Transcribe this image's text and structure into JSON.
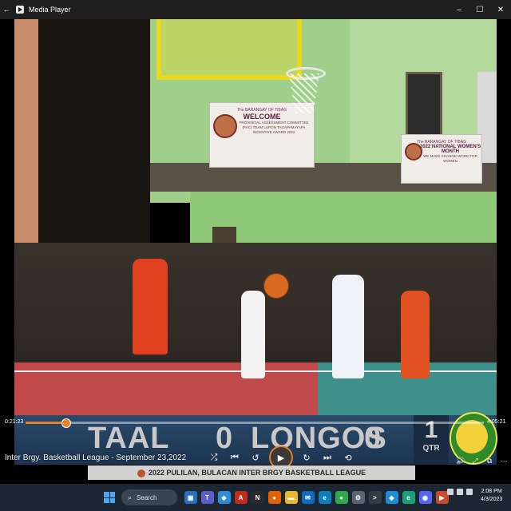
{
  "window": {
    "title": "Media Player",
    "back_icon": "back-arrow-icon",
    "controls": {
      "minimize": "–",
      "maximize": "☐",
      "close": "✕"
    }
  },
  "video_scene": {
    "banner_left": {
      "line1": "The BARANGAY OF TIBAG",
      "line2": "WELCOME",
      "line3": "PROVINCIAL ASSESSMENT COMMITTEE (PAC) TEAM LUPON TAGAPAMAYAPA INCENTIVE AWARD 2022"
    },
    "banner_right": {
      "line1": "The BARANGAY OF TIBAG",
      "line2": "2022 NATIONAL WOMEN'S MONTH",
      "line3": "WE MAKE CHANGE WORK FOR WOMEN"
    }
  },
  "scoreboard": {
    "team_a": "TAAL",
    "score_a": "0",
    "team_b": "LONGOS",
    "score_b": "0",
    "quarter_number": "1",
    "quarter_label": "QTR",
    "bottom_banner": "2022 PULILAN, BULACAN INTER BRGY BASKETBALL LEAGUE"
  },
  "player": {
    "elapsed": "0:21:23",
    "duration": "4:05:21",
    "progress_fraction": 0.087,
    "media_title": "Inter Brgy. Basketball League - September 23,2022",
    "controls": {
      "shuffle": "⤮",
      "previous": "⏮",
      "rewind": "↺",
      "play": "▶",
      "forward": "↻",
      "next": "⏭",
      "repeat": "⟲"
    },
    "right_controls": {
      "volume": "🔊",
      "fullscreen": "⤢",
      "miniplayer": "⧉",
      "more": "⋯"
    }
  },
  "taskbar": {
    "search_placeholder": "Search",
    "time": "2:08 PM",
    "date": "4/3/2023",
    "apps": [
      {
        "icon": "files-icon",
        "glyph": "▣",
        "color": "#2a6fb8"
      },
      {
        "icon": "teams-icon",
        "glyph": "T",
        "color": "#5b5fc7"
      },
      {
        "icon": "store-icon",
        "glyph": "◈",
        "color": "#2d8cd9"
      },
      {
        "icon": "pdf-icon",
        "glyph": "A",
        "color": "#c42b1c"
      },
      {
        "icon": "notion-icon",
        "glyph": "N",
        "color": "#2b2b2b"
      },
      {
        "icon": "firefox-icon",
        "glyph": "●",
        "color": "#e66000"
      },
      {
        "icon": "explorer-icon",
        "glyph": "▬",
        "color": "#e8b830"
      },
      {
        "icon": "mail-icon",
        "glyph": "✉",
        "color": "#0f6cbd"
      },
      {
        "icon": "edge-icon",
        "glyph": "e",
        "color": "#0c7fbf"
      },
      {
        "icon": "chrome-icon",
        "glyph": "●",
        "color": "#2fa84f"
      },
      {
        "icon": "settings-icon",
        "glyph": "⚙",
        "color": "#5a6470"
      },
      {
        "icon": "terminal-icon",
        "glyph": ">",
        "color": "#333b44"
      },
      {
        "icon": "photos-icon",
        "glyph": "◆",
        "color": "#1a8fd8"
      },
      {
        "icon": "edge-dev-icon",
        "glyph": "e",
        "color": "#1f9e7a"
      },
      {
        "icon": "discord-icon",
        "glyph": "◉",
        "color": "#5865f2"
      },
      {
        "icon": "media-player-icon",
        "glyph": "▶",
        "color": "#c84a2a"
      }
    ]
  }
}
